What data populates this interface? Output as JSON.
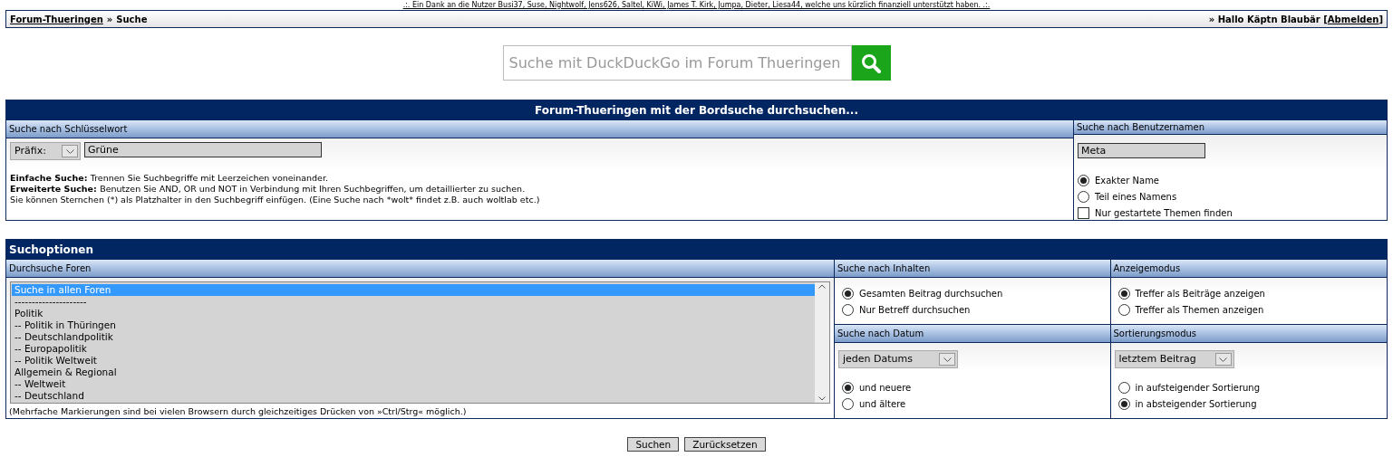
{
  "announcement": ".:. Ein Dank an die Nutzer Busi37, Suse, Nightwolf, Jens626, Saltel, KiWi, James T. Kirk, Jumpa, Dieter, Liesa44, welche uns kürzlich finanziell unterstützt haben. .:.",
  "breadcrumb": {
    "home": "Forum-Thueringen",
    "separator": "»",
    "current": "Suche",
    "greeting": "» Hallo Käptn Blaubär",
    "open_bracket": "[",
    "logout": "Abmelden",
    "close_bracket": "]"
  },
  "web_search": {
    "placeholder": "Suche mit DuckDuckGo im Forum Thueringen"
  },
  "keyword_panel": {
    "title": "Forum-Thueringen mit der Bordsuche durchsuchen...",
    "keyword": {
      "header": "Suche nach Schlüsselwort",
      "prefix": "Präfix:",
      "value": "Grüne",
      "help": [
        {
          "lead": "Einfache Suche:",
          "text": "Trennen Sie Suchbegriffe mit Leerzeichen voneinander."
        },
        {
          "lead": "Erweiterte Suche:",
          "text": "Benutzen Sie AND, OR und NOT in Verbindung mit Ihren Suchbegriffen, um detaillierter zu suchen."
        },
        {
          "text": "Sie können Sternchen (*) als Platzhalter in den Suchbegriff einfügen. (Eine Suche nach *wolt* findet z.B. auch woltlab etc.)"
        }
      ]
    },
    "username": {
      "header": "Suche nach Benutzernamen",
      "value": "Meta",
      "options": [
        {
          "label": "Exakter Name",
          "selected": true
        },
        {
          "label": "Teil eines Namens",
          "selected": false
        }
      ],
      "own_topics": {
        "label": "Nur gestartete Themen finden",
        "checked": false
      }
    }
  },
  "options_panel": {
    "title": "Suchoptionen",
    "forums": {
      "header": "Durchsuche Foren",
      "items": [
        {
          "label": "Suche in allen Foren",
          "selected": true
        },
        {
          "label": "---------------------",
          "selected": false
        },
        {
          "label": "Politik",
          "selected": false
        },
        {
          "label": "-- Politik in Thüringen",
          "selected": false
        },
        {
          "label": "-- Deutschlandpolitik",
          "selected": false
        },
        {
          "label": "-- Europapolitik",
          "selected": false
        },
        {
          "label": "-- Politik Weltweit",
          "selected": false
        },
        {
          "label": "Allgemein & Regional",
          "selected": false
        },
        {
          "label": "-- Weltweit",
          "selected": false
        },
        {
          "label": "-- Deutschland",
          "selected": false
        }
      ],
      "note": "(Mehrfache Markierungen sind bei vielen Browsern durch gleichzeitiges Drücken von »Ctrl/Strg« möglich.)"
    },
    "content": {
      "header": "Suche nach Inhalten",
      "options": [
        {
          "label": "Gesamten Beitrag durchsuchen",
          "selected": true
        },
        {
          "label": "Nur Betreff durchsuchen",
          "selected": false
        }
      ]
    },
    "display": {
      "header": "Anzeigemodus",
      "options": [
        {
          "label": "Treffer als Beiträge anzeigen",
          "selected": true
        },
        {
          "label": "Treffer als Themen anzeigen",
          "selected": false
        }
      ]
    },
    "date": {
      "header": "Suche nach Datum",
      "select": "jeden Datums",
      "options": [
        {
          "label": "und neuere",
          "selected": true
        },
        {
          "label": "und ältere",
          "selected": false
        }
      ]
    },
    "sort": {
      "header": "Sortierungsmodus",
      "select": "letztem Beitrag",
      "options": [
        {
          "label": "in aufsteigender Sortierung",
          "selected": false
        },
        {
          "label": "in absteigender Sortierung",
          "selected": true
        }
      ]
    }
  },
  "buttons": [
    "Suchen",
    "Zurücksetzen"
  ]
}
